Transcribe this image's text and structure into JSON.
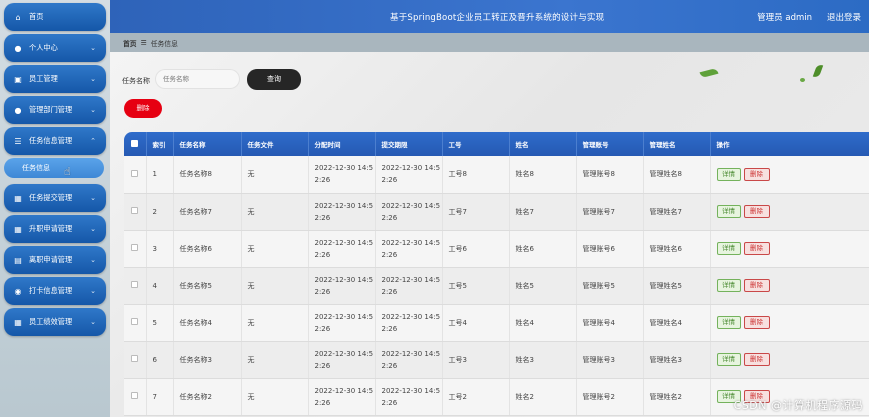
{
  "header": {
    "title": "基于SpringBoot企业员工转正及晋升系统的设计与实现",
    "admin": "管理员 admin",
    "logout": "退出登录"
  },
  "sidebar": {
    "items": [
      {
        "label": "首页",
        "icon": "home-icon"
      },
      {
        "label": "个人中心",
        "icon": "user-icon"
      },
      {
        "label": "员工管理",
        "icon": "briefcase-icon"
      },
      {
        "label": "管理部门管理",
        "icon": "user-icon"
      },
      {
        "label": "任务信息管理",
        "icon": "list-icon"
      },
      {
        "label": "任务提交管理",
        "icon": "grid-icon"
      },
      {
        "label": "升职申请管理",
        "icon": "grid-icon"
      },
      {
        "label": "离职申请管理",
        "icon": "calendar-icon"
      },
      {
        "label": "打卡信息管理",
        "icon": "pin-icon"
      },
      {
        "label": "员工绩效管理",
        "icon": "grid-icon"
      }
    ],
    "sub_item": "任务信息"
  },
  "breadcrumb": {
    "home": "首页",
    "sep": "☰",
    "current": "任务信息"
  },
  "search": {
    "label": "任务名称",
    "placeholder": "任务名称",
    "button": "查询"
  },
  "delete_button": "删除",
  "table": {
    "headers": [
      "索引",
      "任务名称",
      "任务文件",
      "分配时间",
      "提交期限",
      "工号",
      "姓名",
      "管理账号",
      "管理姓名",
      "操作"
    ],
    "detail_label": "详情",
    "delete_label": "删除",
    "rows": [
      {
        "index": "1",
        "name": "任务名称8",
        "file": "无",
        "assign1": "2022-12-30 14:5",
        "assign2": "2:26",
        "deadline1": "2022-12-30 14:5",
        "deadline2": "2:26",
        "job_no": "工号8",
        "emp_name": "姓名8",
        "mgr_account": "管理账号8",
        "mgr_name": "管理姓名8"
      },
      {
        "index": "2",
        "name": "任务名称7",
        "file": "无",
        "assign1": "2022-12-30 14:5",
        "assign2": "2:26",
        "deadline1": "2022-12-30 14:5",
        "deadline2": "2:26",
        "job_no": "工号7",
        "emp_name": "姓名7",
        "mgr_account": "管理账号7",
        "mgr_name": "管理姓名7"
      },
      {
        "index": "3",
        "name": "任务名称6",
        "file": "无",
        "assign1": "2022-12-30 14:5",
        "assign2": "2:26",
        "deadline1": "2022-12-30 14:5",
        "deadline2": "2:26",
        "job_no": "工号6",
        "emp_name": "姓名6",
        "mgr_account": "管理账号6",
        "mgr_name": "管理姓名6"
      },
      {
        "index": "4",
        "name": "任务名称5",
        "file": "无",
        "assign1": "2022-12-30 14:5",
        "assign2": "2:26",
        "deadline1": "2022-12-30 14:5",
        "deadline2": "2:26",
        "job_no": "工号5",
        "emp_name": "姓名5",
        "mgr_account": "管理账号5",
        "mgr_name": "管理姓名5"
      },
      {
        "index": "5",
        "name": "任务名称4",
        "file": "无",
        "assign1": "2022-12-30 14:5",
        "assign2": "2:26",
        "deadline1": "2022-12-30 14:5",
        "deadline2": "2:26",
        "job_no": "工号4",
        "emp_name": "姓名4",
        "mgr_account": "管理账号4",
        "mgr_name": "管理姓名4"
      },
      {
        "index": "6",
        "name": "任务名称3",
        "file": "无",
        "assign1": "2022-12-30 14:5",
        "assign2": "2:26",
        "deadline1": "2022-12-30 14:5",
        "deadline2": "2:26",
        "job_no": "工号3",
        "emp_name": "姓名3",
        "mgr_account": "管理账号3",
        "mgr_name": "管理姓名3"
      },
      {
        "index": "7",
        "name": "任务名称2",
        "file": "无",
        "assign1": "2022-12-30 14:5",
        "assign2": "2:26",
        "deadline1": "2022-12-30 14:5",
        "deadline2": "2:26",
        "job_no": "工号2",
        "emp_name": "姓名2",
        "mgr_account": "管理账号2",
        "mgr_name": "管理姓名2"
      }
    ]
  },
  "watermark": "CSDN @计算机程序源码",
  "colors": {
    "header": "#2e63b9",
    "sidebar_item": "#1557a8",
    "search_button": "#262626",
    "delete_button": "#e60012"
  }
}
